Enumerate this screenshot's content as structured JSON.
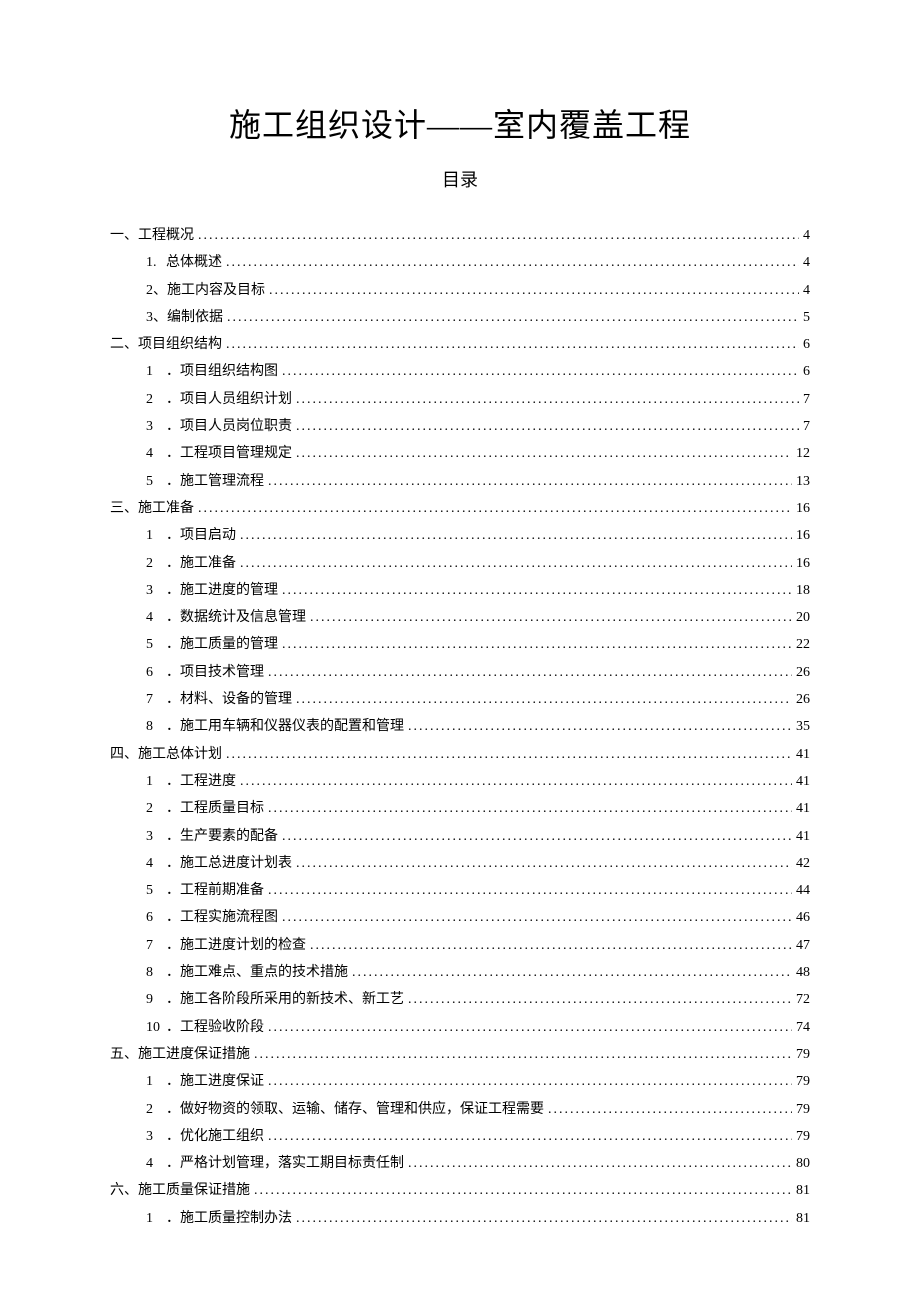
{
  "title": "施工组织设计——室内覆盖工程",
  "subtitle": "目录",
  "toc": [
    {
      "level": 1,
      "num": "一、",
      "label": "工程概况",
      "page": "4"
    },
    {
      "level": 2,
      "num": "1.",
      "label": "总体概述",
      "page": "4"
    },
    {
      "level": 2,
      "num": "2、",
      "label": "施工内容及目标",
      "page": "4"
    },
    {
      "level": 2,
      "num": "3、",
      "label": "编制依据",
      "page": "5"
    },
    {
      "level": 1,
      "num": "二、",
      "label": "项目组织结构",
      "page": "6"
    },
    {
      "level": 2,
      "num": "1",
      "label": "．项目组织结构图",
      "page": "6"
    },
    {
      "level": 2,
      "num": "2",
      "label": "．项目人员组织计划",
      "page": "7"
    },
    {
      "level": 2,
      "num": "3",
      "label": "．项目人员岗位职责",
      "page": "7"
    },
    {
      "level": 2,
      "num": "4",
      "label": "．工程项目管理规定",
      "page": "12"
    },
    {
      "level": 2,
      "num": "5",
      "label": "．施工管理流程",
      "page": "13"
    },
    {
      "level": 1,
      "num": "三、",
      "label": "施工准备",
      "page": "16"
    },
    {
      "level": 2,
      "num": "1",
      "label": "．项目启动",
      "page": "16"
    },
    {
      "level": 2,
      "num": "2",
      "label": "．施工准备",
      "page": "16"
    },
    {
      "level": 2,
      "num": "3",
      "label": "．施工进度的管理",
      "page": "18"
    },
    {
      "level": 2,
      "num": "4",
      "label": "．数据统计及信息管理",
      "page": "20"
    },
    {
      "level": 2,
      "num": "5",
      "label": "．施工质量的管理",
      "page": "22"
    },
    {
      "level": 2,
      "num": "6",
      "label": "．项目技术管理",
      "page": "26"
    },
    {
      "level": 2,
      "num": "7",
      "label": "．材料、设备的管理",
      "page": "26"
    },
    {
      "level": 2,
      "num": "8",
      "label": "．施工用车辆和仪器仪表的配置和管理",
      "page": "35"
    },
    {
      "level": 1,
      "num": "四、",
      "label": "施工总体计划",
      "page": "41"
    },
    {
      "level": 2,
      "num": "1",
      "label": "．工程进度",
      "page": "41"
    },
    {
      "level": 2,
      "num": "2",
      "label": "．工程质量目标",
      "page": "41"
    },
    {
      "level": 2,
      "num": "3",
      "label": "．生产要素的配备",
      "page": "41"
    },
    {
      "level": 2,
      "num": "4",
      "label": "．施工总进度计划表",
      "page": "42"
    },
    {
      "level": 2,
      "num": "5",
      "label": "．工程前期准备",
      "page": "44"
    },
    {
      "level": 2,
      "num": "6",
      "label": "．工程实施流程图",
      "page": "46"
    },
    {
      "level": 2,
      "num": "7",
      "label": "．施工进度计划的检查",
      "page": "47"
    },
    {
      "level": 2,
      "num": "8",
      "label": "．施工难点、重点的技术措施",
      "page": "48"
    },
    {
      "level": 2,
      "num": "9",
      "label": "．施工各阶段所采用的新技术、新工艺",
      "page": "72"
    },
    {
      "level": 2,
      "num": "10",
      "label": "．工程验收阶段",
      "page": "74"
    },
    {
      "level": 1,
      "num": "五、",
      "label": "施工进度保证措施",
      "page": "79"
    },
    {
      "level": 2,
      "num": "1",
      "label": "．施工进度保证",
      "page": "79"
    },
    {
      "level": 2,
      "num": "2",
      "label": "．做好物资的领取、运输、储存、管理和供应，保证工程需要",
      "page": "79"
    },
    {
      "level": 2,
      "num": "3",
      "label": "．优化施工组织",
      "page": "79"
    },
    {
      "level": 2,
      "num": "4",
      "label": "．严格计划管理，落实工期目标责任制",
      "page": "80"
    },
    {
      "level": 1,
      "num": "六、",
      "label": "施工质量保证措施",
      "page": "81"
    },
    {
      "level": 2,
      "num": "1",
      "label": "．施工质量控制办法",
      "page": "81"
    }
  ]
}
